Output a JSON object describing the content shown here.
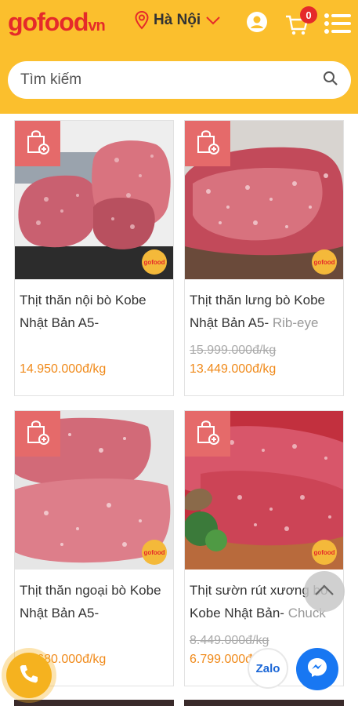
{
  "header": {
    "logo": {
      "part1": "go",
      "part2": "food",
      "part3": "vn"
    },
    "location": "Hà Nội",
    "cart_count": "0",
    "icons": [
      "location-pin-icon",
      "chevron-down-icon",
      "user-icon",
      "cart-icon",
      "menu-icon"
    ]
  },
  "search": {
    "placeholder": "Tìm kiếm",
    "icon": "search-icon"
  },
  "products": [
    {
      "name_main": "Thịt thăn nội bò Kobe Nhật Bản A5-",
      "name_muted": "",
      "old_price": "",
      "price": "14.950.000đ/kg"
    },
    {
      "name_main": "Thịt thăn lưng bò Kobe Nhật Bản A5-",
      "name_muted": " Rib-eye",
      "old_price": "15.999.000đ/kg",
      "price": "13.449.000đ/kg"
    },
    {
      "name_main": "Thịt thăn ngoại bò Kobe Nhật Bản A5-",
      "name_muted": "",
      "old_price": "",
      "price": "14.680.000đ/kg"
    },
    {
      "name_main": "Thịt sườn rút xương bò Kobe Nhật Bản-",
      "name_muted": " Chuck",
      "old_price": "8.449.000đ/kg",
      "price": "6.799.000đ/kg"
    }
  ],
  "badge_text": "gofood",
  "floating": {
    "zalo_label": "Zalo"
  },
  "colors": {
    "brand_yellow": "#fbbf2d",
    "brand_red": "#e52a2a",
    "price_orange": "#f08a1a",
    "messenger_blue": "#1877f2"
  }
}
